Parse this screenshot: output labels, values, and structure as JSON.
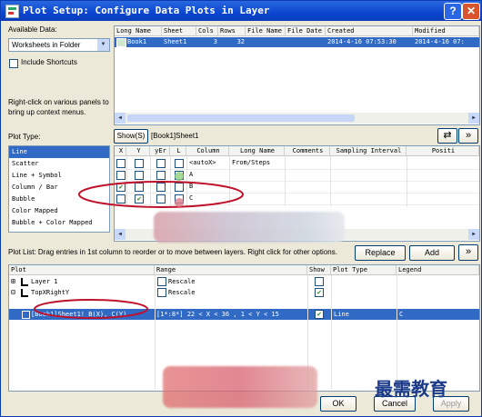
{
  "window": {
    "title": "Plot Setup: Configure Data Plots in Layer",
    "help_label": "?",
    "close_label": "✕"
  },
  "available_data": {
    "label": "Available Data:",
    "selected": "Worksheets in Folder",
    "include_shortcuts": "Include Shortcuts",
    "hint": "Right-click on various panels to bring up context menus."
  },
  "data_table": {
    "columns": [
      "Long Name",
      "Sheet",
      "Cols",
      "Rows",
      "File Name",
      "File Date",
      "Created",
      "Modified"
    ],
    "rows": [
      {
        "long_name": "Book1",
        "sheet": "Sheet1",
        "cols": "3",
        "rows": "32",
        "file_name": "",
        "file_date": "",
        "created": "2014-4-16 07:53:30",
        "modified": "2014-4-16 07:"
      }
    ]
  },
  "plot_type": {
    "label": "Plot Type:",
    "items": [
      "Line",
      "Scatter",
      "Line + Symbol",
      "Column / Bar",
      "Bubble",
      "Color Mapped",
      "Bubble + Color Mapped"
    ],
    "selected_index": 0
  },
  "show_bar": {
    "show_label": "Show(S)",
    "path": "[Book1]Sheet1",
    "swap_icon": "⇄",
    "collapse_icon": "»"
  },
  "column_table": {
    "columns": [
      "X",
      "Y",
      "yEr",
      "L",
      "Column",
      "Long Name",
      "Comments",
      "Sampling Interval",
      "Positi"
    ],
    "rows": [
      {
        "x": false,
        "y": false,
        "yer": false,
        "l": false,
        "column": "<autoX>",
        "long_name": "From/Steps"
      },
      {
        "x": false,
        "y": false,
        "yer": false,
        "l": false,
        "column": "A",
        "long_name": ""
      },
      {
        "x": true,
        "y": false,
        "yer": false,
        "l": false,
        "column": "B",
        "long_name": ""
      },
      {
        "x": false,
        "y": true,
        "yer": false,
        "l": false,
        "column": "C",
        "long_name": ""
      }
    ]
  },
  "plot_list": {
    "hint": "Plot List: Drag entries in 1st column to reorder or to move between layers. Right click for other options.",
    "replace_label": "Replace",
    "add_label": "Add",
    "collapse_icon": "»",
    "columns": [
      "Plot",
      "Range",
      "Show",
      "Plot Type",
      "Legend"
    ],
    "rows": [
      {
        "expander": "⊞",
        "plot": "Layer 1",
        "range": "Rescale",
        "show": false,
        "plot_type": "",
        "legend": "",
        "selected": false
      },
      {
        "expander": "⊟",
        "plot": "TopXRightY",
        "range": "Rescale",
        "show": true,
        "plot_type": "",
        "legend": "",
        "selected": false
      },
      {
        "expander": "",
        "plot": "[Book1]Sheet1! B(X), C(Y)",
        "range": "[1*:8*]  22 < X < 36 , 1 < Y < 15",
        "show": true,
        "plot_type": "Line",
        "legend": "C",
        "selected": true
      }
    ]
  },
  "footer": {
    "ok_label": "OK",
    "cancel_label": "Cancel",
    "apply_label": "Apply"
  },
  "watermark": {
    "text": "最需教育"
  }
}
